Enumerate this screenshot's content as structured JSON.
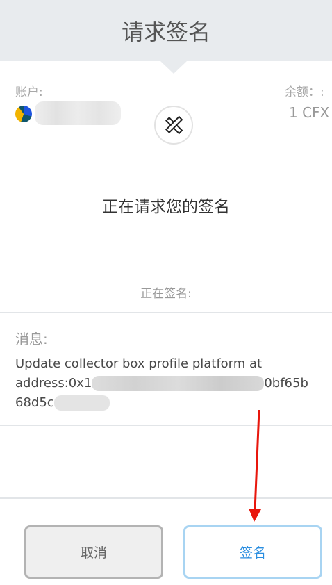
{
  "header": {
    "title": "请求签名"
  },
  "account": {
    "label": "账户:"
  },
  "balance": {
    "label": "余额：:",
    "value": "1 CFX"
  },
  "site_logo": "crossed-tools-icon",
  "request": {
    "heading": "正在请求您的签名",
    "signing_label": "正在签名:"
  },
  "message": {
    "label": "消息:",
    "line1": "Update collector box profile platform at",
    "line2_start": "address:0x1",
    "line2_end": "0bf65b",
    "line3_start": "68d5c"
  },
  "buttons": {
    "cancel": "取消",
    "sign": "签名"
  },
  "colors": {
    "header_bg": "#e8ebee",
    "sign_text": "#2a8ee0",
    "sign_border": "#a8d4f2",
    "annotation_arrow": "#e8160c"
  }
}
